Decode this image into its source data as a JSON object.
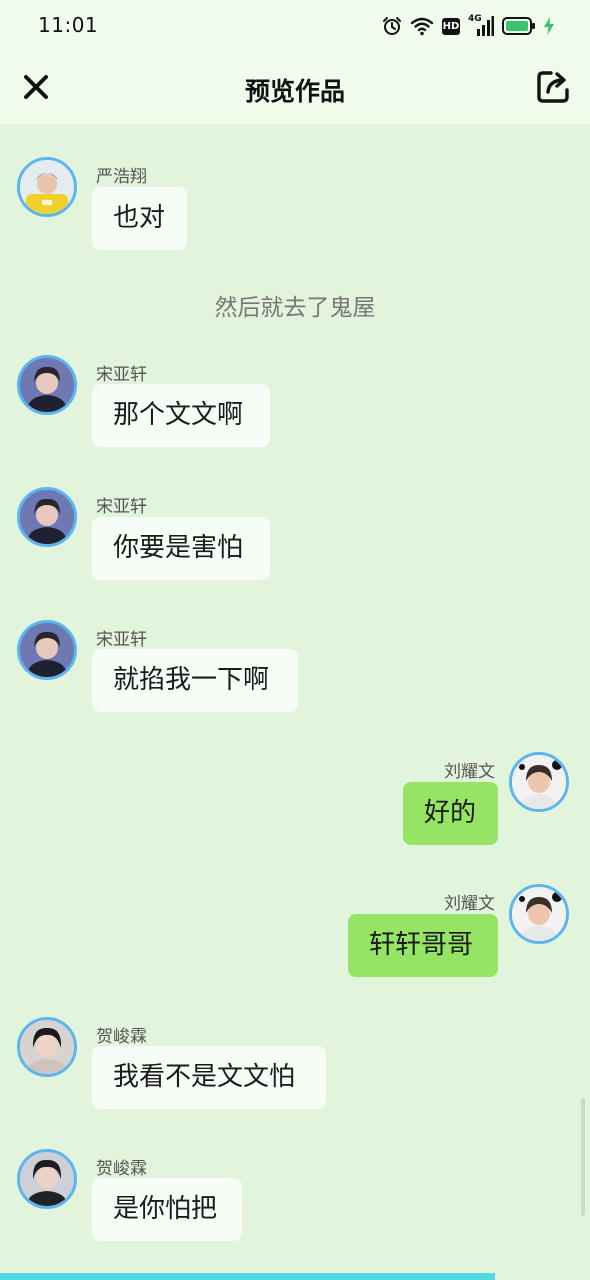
{
  "status_bar": {
    "time": "11:01",
    "icons": [
      "alarm-icon",
      "wifi-icon",
      "hd-icon",
      "signal-4g-icon",
      "battery-icon",
      "charging-icon"
    ],
    "hd_label": "HD",
    "network_label": "4G"
  },
  "header": {
    "title": "预览作品",
    "close_icon": "close-icon",
    "share_icon": "share-icon"
  },
  "colors": {
    "background": "#e3f4dc",
    "header_background": "#f0fbec",
    "incoming_bubble": "#f6fcf6",
    "outgoing_bubble": "#95e463",
    "avatar_border": "#5cb6ee",
    "progress_line": "#4fd9e3"
  },
  "messages": [
    {
      "type": "incoming",
      "sender": "严浩翔",
      "text": "也对"
    },
    {
      "type": "system",
      "text": "然后就去了鬼屋"
    },
    {
      "type": "incoming",
      "sender": "宋亚轩",
      "text": "那个文文啊"
    },
    {
      "type": "incoming",
      "sender": "宋亚轩",
      "text": "你要是害怕"
    },
    {
      "type": "incoming",
      "sender": "宋亚轩",
      "text": "就掐我一下啊"
    },
    {
      "type": "outgoing",
      "sender": "刘耀文",
      "text": "好的"
    },
    {
      "type": "outgoing",
      "sender": "刘耀文",
      "text": "轩轩哥哥"
    },
    {
      "type": "incoming",
      "sender": "贺峻霖",
      "text": "我看不是文文怕"
    },
    {
      "type": "incoming",
      "sender": "贺峻霖",
      "text": "是你怕把"
    }
  ]
}
